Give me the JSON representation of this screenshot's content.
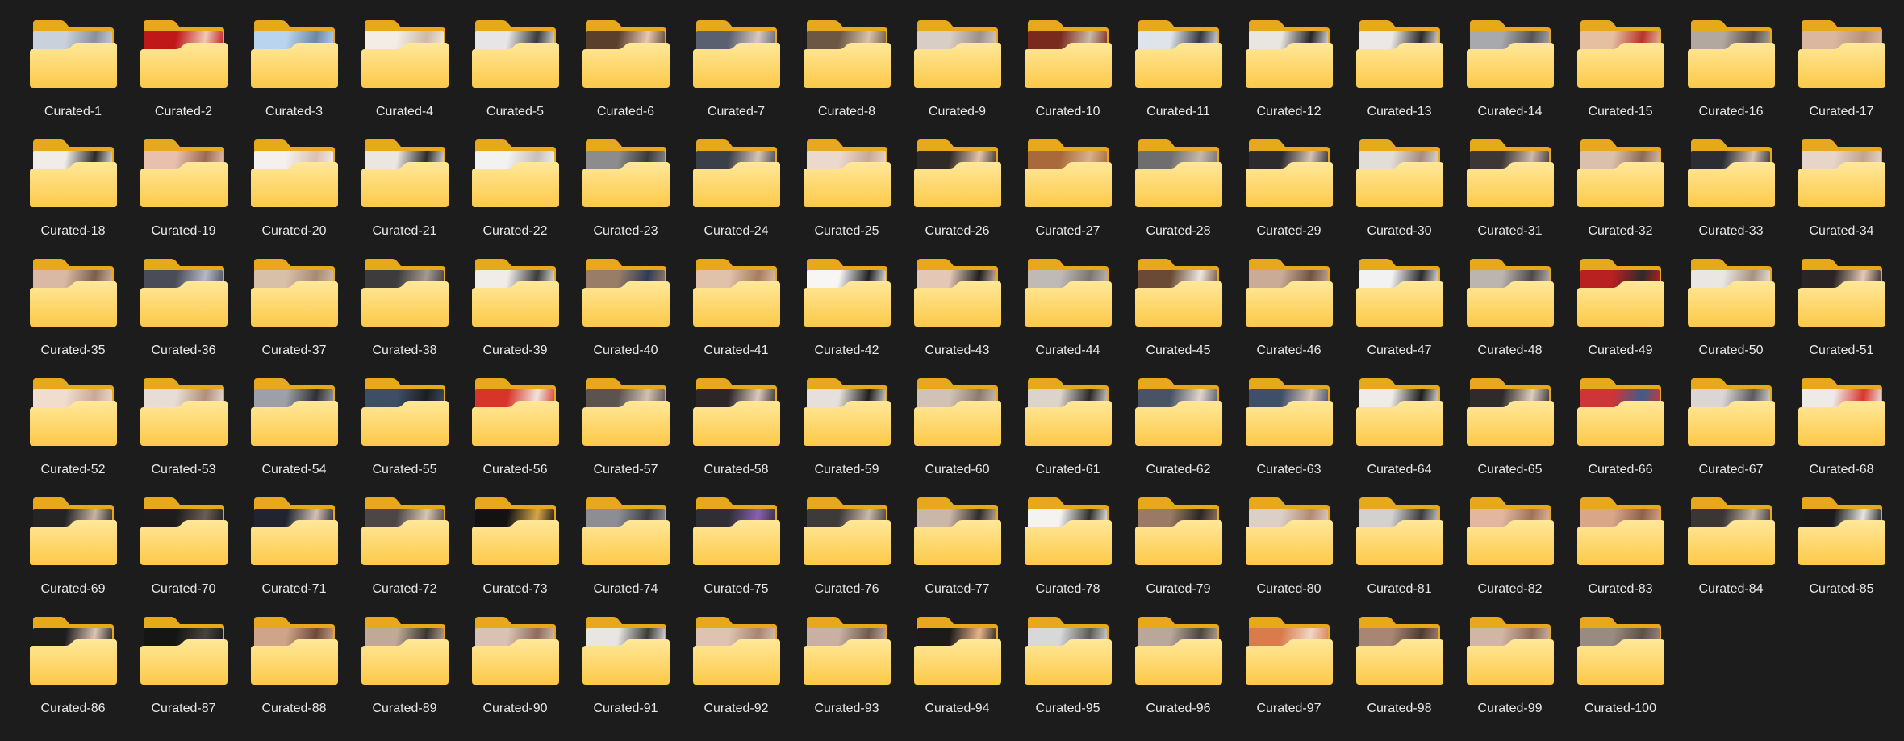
{
  "view": "icon-grid",
  "colors": {
    "background": "#1c1c1c",
    "label": "#e8e8e8",
    "folder_back": "#e8a81c",
    "folder_front_top": "#ffe89a",
    "folder_front_bottom": "#fcc948"
  },
  "folders": [
    {
      "name": "Curated-1",
      "icon": "folder-icon",
      "thumb_colors": [
        "#c9d2dc",
        "#8a9099"
      ]
    },
    {
      "name": "Curated-2",
      "icon": "folder-icon",
      "thumb_colors": [
        "#c01818",
        "#f2c7b7"
      ]
    },
    {
      "name": "Curated-3",
      "icon": "folder-icon",
      "thumb_colors": [
        "#b9d4ef",
        "#6d88a6"
      ]
    },
    {
      "name": "Curated-4",
      "icon": "folder-icon",
      "thumb_colors": [
        "#f3ede6",
        "#cdb9a6"
      ]
    },
    {
      "name": "Curated-5",
      "icon": "folder-icon",
      "thumb_colors": [
        "#e7e5e5",
        "#3a3a3a"
      ]
    },
    {
      "name": "Curated-6",
      "icon": "folder-icon",
      "thumb_colors": [
        "#5a3f2c",
        "#e8c8b2"
      ]
    },
    {
      "name": "Curated-7",
      "icon": "folder-icon",
      "thumb_colors": [
        "#5a6070",
        "#d8c8c0"
      ]
    },
    {
      "name": "Curated-8",
      "icon": "folder-icon",
      "thumb_colors": [
        "#6b5743",
        "#d9c1ac"
      ]
    },
    {
      "name": "Curated-9",
      "icon": "folder-icon",
      "thumb_colors": [
        "#d8cec6",
        "#9d9089"
      ]
    },
    {
      "name": "Curated-10",
      "icon": "folder-icon",
      "thumb_colors": [
        "#7a2a1c",
        "#c9b9a9"
      ]
    },
    {
      "name": "Curated-11",
      "icon": "folder-icon",
      "thumb_colors": [
        "#dfe3ea",
        "#333840"
      ]
    },
    {
      "name": "Curated-12",
      "icon": "folder-icon",
      "thumb_colors": [
        "#e9e6e2",
        "#262626"
      ]
    },
    {
      "name": "Curated-13",
      "icon": "folder-icon",
      "thumb_colors": [
        "#ece8e5",
        "#2a2a2a"
      ]
    },
    {
      "name": "Curated-14",
      "icon": "folder-icon",
      "thumb_colors": [
        "#a8a9ad",
        "#585452"
      ]
    },
    {
      "name": "Curated-15",
      "icon": "folder-icon",
      "thumb_colors": [
        "#e5bf9f",
        "#b8332a"
      ]
    },
    {
      "name": "Curated-16",
      "icon": "folder-icon",
      "thumb_colors": [
        "#b3a89f",
        "#5a4f48"
      ]
    },
    {
      "name": "Curated-17",
      "icon": "folder-icon",
      "thumb_colors": [
        "#dcb7a0",
        "#b8927c"
      ]
    },
    {
      "name": "Curated-18",
      "icon": "folder-icon",
      "thumb_colors": [
        "#f0ede8",
        "#2a2a2a"
      ]
    },
    {
      "name": "Curated-19",
      "icon": "folder-icon",
      "thumb_colors": [
        "#e8c0ad",
        "#9b6a52"
      ]
    },
    {
      "name": "Curated-20",
      "icon": "folder-icon",
      "thumb_colors": [
        "#f3f0ee",
        "#d9c1b3"
      ]
    },
    {
      "name": "Curated-21",
      "icon": "folder-icon",
      "thumb_colors": [
        "#ece6e0",
        "#2b2b2b"
      ]
    },
    {
      "name": "Curated-22",
      "icon": "folder-icon",
      "thumb_colors": [
        "#f2f2f0",
        "#c8c0b8"
      ]
    },
    {
      "name": "Curated-23",
      "icon": "folder-icon",
      "thumb_colors": [
        "#8c8c8c",
        "#3a3a3a"
      ]
    },
    {
      "name": "Curated-24",
      "icon": "folder-icon",
      "thumb_colors": [
        "#3b3f48",
        "#d7c4b6"
      ]
    },
    {
      "name": "Curated-25",
      "icon": "folder-icon",
      "thumb_colors": [
        "#ecd9ce",
        "#c9a996"
      ]
    },
    {
      "name": "Curated-26",
      "icon": "folder-icon",
      "thumb_colors": [
        "#302a26",
        "#e5c4ac"
      ]
    },
    {
      "name": "Curated-27",
      "icon": "folder-icon",
      "thumb_colors": [
        "#a86a3a",
        "#d9b08a"
      ]
    },
    {
      "name": "Curated-28",
      "icon": "folder-icon",
      "thumb_colors": [
        "#6f6e6e",
        "#c8b8ac"
      ]
    },
    {
      "name": "Curated-29",
      "icon": "folder-icon",
      "thumb_colors": [
        "#2c2a2d",
        "#d6c2b4"
      ]
    },
    {
      "name": "Curated-30",
      "icon": "folder-icon",
      "thumb_colors": [
        "#e3ddd7",
        "#a58d7e"
      ]
    },
    {
      "name": "Curated-31",
      "icon": "folder-icon",
      "thumb_colors": [
        "#3c3634",
        "#cfb9aa"
      ]
    },
    {
      "name": "Curated-32",
      "icon": "folder-icon",
      "thumb_colors": [
        "#dbc1ac",
        "#8d6a54"
      ]
    },
    {
      "name": "Curated-33",
      "icon": "folder-icon",
      "thumb_colors": [
        "#2b2d33",
        "#d8c3b3"
      ]
    },
    {
      "name": "Curated-34",
      "icon": "folder-icon",
      "thumb_colors": [
        "#e7d6c8",
        "#c2a48e"
      ]
    },
    {
      "name": "Curated-35",
      "icon": "folder-icon",
      "thumb_colors": [
        "#d9b9a3",
        "#7a5e4c"
      ]
    },
    {
      "name": "Curated-36",
      "icon": "folder-icon",
      "thumb_colors": [
        "#4a4c58",
        "#b6b8c5"
      ]
    },
    {
      "name": "Curated-37",
      "icon": "folder-icon",
      "thumb_colors": [
        "#d8bfa8",
        "#a78a72"
      ]
    },
    {
      "name": "Curated-38",
      "icon": "folder-icon",
      "thumb_colors": [
        "#3e3b3c",
        "#a49a90"
      ]
    },
    {
      "name": "Curated-39",
      "icon": "folder-icon",
      "thumb_colors": [
        "#f0ece8",
        "#3b3b3b"
      ]
    },
    {
      "name": "Curated-40",
      "icon": "folder-icon",
      "thumb_colors": [
        "#9a7d67",
        "#2f3b55"
      ]
    },
    {
      "name": "Curated-41",
      "icon": "folder-icon",
      "thumb_colors": [
        "#e0c2ab",
        "#a77c5e"
      ]
    },
    {
      "name": "Curated-42",
      "icon": "folder-icon",
      "thumb_colors": [
        "#f7f6f5",
        "#222222"
      ]
    },
    {
      "name": "Curated-43",
      "icon": "folder-icon",
      "thumb_colors": [
        "#e4c7b4",
        "#1e1e1e"
      ]
    },
    {
      "name": "Curated-44",
      "icon": "folder-icon",
      "thumb_colors": [
        "#bfbab5",
        "#7c766f"
      ]
    },
    {
      "name": "Curated-45",
      "icon": "folder-icon",
      "thumb_colors": [
        "#6a4a34",
        "#eee8e2"
      ]
    },
    {
      "name": "Curated-46",
      "icon": "folder-icon",
      "thumb_colors": [
        "#c9ab96",
        "#6f5442"
      ]
    },
    {
      "name": "Curated-47",
      "icon": "folder-icon",
      "thumb_colors": [
        "#f2f2f2",
        "#2a2a2a"
      ]
    },
    {
      "name": "Curated-48",
      "icon": "folder-icon",
      "thumb_colors": [
        "#bcb4ae",
        "#4e4a48"
      ]
    },
    {
      "name": "Curated-49",
      "icon": "folder-icon",
      "thumb_colors": [
        "#b92020",
        "#2d2a2a"
      ]
    },
    {
      "name": "Curated-50",
      "icon": "folder-icon",
      "thumb_colors": [
        "#e9e6e3",
        "#a7917e"
      ]
    },
    {
      "name": "Curated-51",
      "icon": "folder-icon",
      "thumb_colors": [
        "#2a2424",
        "#e6c9b5"
      ]
    },
    {
      "name": "Curated-52",
      "icon": "folder-icon",
      "thumb_colors": [
        "#f1ddd0",
        "#c9a894"
      ]
    },
    {
      "name": "Curated-53",
      "icon": "folder-icon",
      "thumb_colors": [
        "#e7ddd6",
        "#b28e77"
      ]
    },
    {
      "name": "Curated-54",
      "icon": "folder-icon",
      "thumb_colors": [
        "#9ca0a8",
        "#2f2f33"
      ]
    },
    {
      "name": "Curated-55",
      "icon": "folder-icon",
      "thumb_colors": [
        "#3d4f66",
        "#1c1d22"
      ]
    },
    {
      "name": "Curated-56",
      "icon": "folder-icon",
      "thumb_colors": [
        "#d8342a",
        "#f0e4dc"
      ]
    },
    {
      "name": "Curated-57",
      "icon": "folder-icon",
      "thumb_colors": [
        "#5b534d",
        "#d2c0b2"
      ]
    },
    {
      "name": "Curated-58",
      "icon": "folder-icon",
      "thumb_colors": [
        "#2c2627",
        "#ddc9bc"
      ]
    },
    {
      "name": "Curated-59",
      "icon": "folder-icon",
      "thumb_colors": [
        "#e5e0db",
        "#1f1f1f"
      ]
    },
    {
      "name": "Curated-60",
      "icon": "folder-icon",
      "thumb_colors": [
        "#d2c2b6",
        "#8c7a6e"
      ]
    },
    {
      "name": "Curated-61",
      "icon": "folder-icon",
      "thumb_colors": [
        "#dcd3cb",
        "#2a2a2a"
      ]
    },
    {
      "name": "Curated-62",
      "icon": "folder-icon",
      "thumb_colors": [
        "#4a5366",
        "#e2d6cc"
      ]
    },
    {
      "name": "Curated-63",
      "icon": "folder-icon",
      "thumb_colors": [
        "#3f4f6a",
        "#d7c2b3"
      ]
    },
    {
      "name": "Curated-64",
      "icon": "folder-icon",
      "thumb_colors": [
        "#efebe7",
        "#1d1d1d"
      ]
    },
    {
      "name": "Curated-65",
      "icon": "folder-icon",
      "thumb_colors": [
        "#2f2b2b",
        "#e0cdbf"
      ]
    },
    {
      "name": "Curated-66",
      "icon": "folder-icon",
      "thumb_colors": [
        "#cf3438",
        "#3e5d8a"
      ]
    },
    {
      "name": "Curated-67",
      "icon": "folder-icon",
      "thumb_colors": [
        "#dad6d3",
        "#5b5a5d"
      ]
    },
    {
      "name": "Curated-68",
      "icon": "folder-icon",
      "thumb_colors": [
        "#eeeae7",
        "#d8352c"
      ]
    },
    {
      "name": "Curated-69",
      "icon": "folder-icon",
      "thumb_colors": [
        "#252425",
        "#c9b3a3"
      ]
    },
    {
      "name": "Curated-70",
      "icon": "folder-icon",
      "thumb_colors": [
        "#1e1c1d",
        "#6d5d55"
      ]
    },
    {
      "name": "Curated-71",
      "icon": "folder-icon",
      "thumb_colors": [
        "#1f2430",
        "#d4c0b4"
      ]
    },
    {
      "name": "Curated-72",
      "icon": "folder-icon",
      "thumb_colors": [
        "#4c4746",
        "#d8c4b3"
      ]
    },
    {
      "name": "Curated-73",
      "icon": "folder-icon",
      "thumb_colors": [
        "#121212",
        "#d6a54a"
      ]
    },
    {
      "name": "Curated-74",
      "icon": "folder-icon",
      "thumb_colors": [
        "#8d8e93",
        "#3d3e44"
      ]
    },
    {
      "name": "Curated-75",
      "icon": "folder-icon",
      "thumb_colors": [
        "#2e2e34",
        "#8a5fb5"
      ]
    },
    {
      "name": "Curated-76",
      "icon": "folder-icon",
      "thumb_colors": [
        "#3d3a3a",
        "#cbb8aa"
      ]
    },
    {
      "name": "Curated-77",
      "icon": "folder-icon",
      "thumb_colors": [
        "#cbb7a7",
        "#2f2b2a"
      ]
    },
    {
      "name": "Curated-78",
      "icon": "folder-icon",
      "thumb_colors": [
        "#f4f3f1",
        "#2e2e2e"
      ]
    },
    {
      "name": "Curated-79",
      "icon": "folder-icon",
      "thumb_colors": [
        "#9a7a62",
        "#2a2625"
      ]
    },
    {
      "name": "Curated-80",
      "icon": "folder-icon",
      "thumb_colors": [
        "#dccfc8",
        "#b28a72"
      ]
    },
    {
      "name": "Curated-81",
      "icon": "folder-icon",
      "thumb_colors": [
        "#d3d1d0",
        "#3b3b3e"
      ]
    },
    {
      "name": "Curated-82",
      "icon": "folder-icon",
      "thumb_colors": [
        "#e2b79e",
        "#a07359"
      ]
    },
    {
      "name": "Curated-83",
      "icon": "folder-icon",
      "thumb_colors": [
        "#d9a68a",
        "#8f604a"
      ]
    },
    {
      "name": "Curated-84",
      "icon": "folder-icon",
      "thumb_colors": [
        "#3a3634",
        "#c8b6a8"
      ]
    },
    {
      "name": "Curated-85",
      "icon": "folder-icon",
      "thumb_colors": [
        "#1c1b1c",
        "#e8e6e4"
      ]
    },
    {
      "name": "Curated-86",
      "icon": "folder-icon",
      "thumb_colors": [
        "#1e1d1e",
        "#dcc4b3"
      ]
    },
    {
      "name": "Curated-87",
      "icon": "folder-icon",
      "thumb_colors": [
        "#161516",
        "#4a423f"
      ]
    },
    {
      "name": "Curated-88",
      "icon": "folder-icon",
      "thumb_colors": [
        "#cfa488",
        "#6c4a38"
      ]
    },
    {
      "name": "Curated-89",
      "icon": "folder-icon",
      "thumb_colors": [
        "#c0a995",
        "#3a3533"
      ]
    },
    {
      "name": "Curated-90",
      "icon": "folder-icon",
      "thumb_colors": [
        "#dac2b2",
        "#8b6c5b"
      ]
    },
    {
      "name": "Curated-91",
      "icon": "folder-icon",
      "thumb_colors": [
        "#e9e5e2",
        "#3a3a3a"
      ]
    },
    {
      "name": "Curated-92",
      "icon": "folder-icon",
      "thumb_colors": [
        "#ddc3b0",
        "#a48670"
      ]
    },
    {
      "name": "Curated-93",
      "icon": "folder-icon",
      "thumb_colors": [
        "#c9b0a2",
        "#6f5b50"
      ]
    },
    {
      "name": "Curated-94",
      "icon": "folder-icon",
      "thumb_colors": [
        "#1d1a1a",
        "#e6b48a"
      ]
    },
    {
      "name": "Curated-95",
      "icon": "folder-icon",
      "thumb_colors": [
        "#d9d8d8",
        "#5a5a5c"
      ]
    },
    {
      "name": "Curated-96",
      "icon": "folder-icon",
      "thumb_colors": [
        "#b9a79a",
        "#4b4543"
      ]
    },
    {
      "name": "Curated-97",
      "icon": "folder-icon",
      "thumb_colors": [
        "#d97c4c",
        "#f0d7c6"
      ]
    },
    {
      "name": "Curated-98",
      "icon": "folder-icon",
      "thumb_colors": [
        "#a88772",
        "#4d3c32"
      ]
    },
    {
      "name": "Curated-99",
      "icon": "folder-icon",
      "thumb_colors": [
        "#d1b6a3",
        "#8a6b58"
      ]
    },
    {
      "name": "Curated-100",
      "icon": "folder-icon",
      "thumb_colors": [
        "#9a8b80",
        "#5c5049"
      ]
    }
  ]
}
